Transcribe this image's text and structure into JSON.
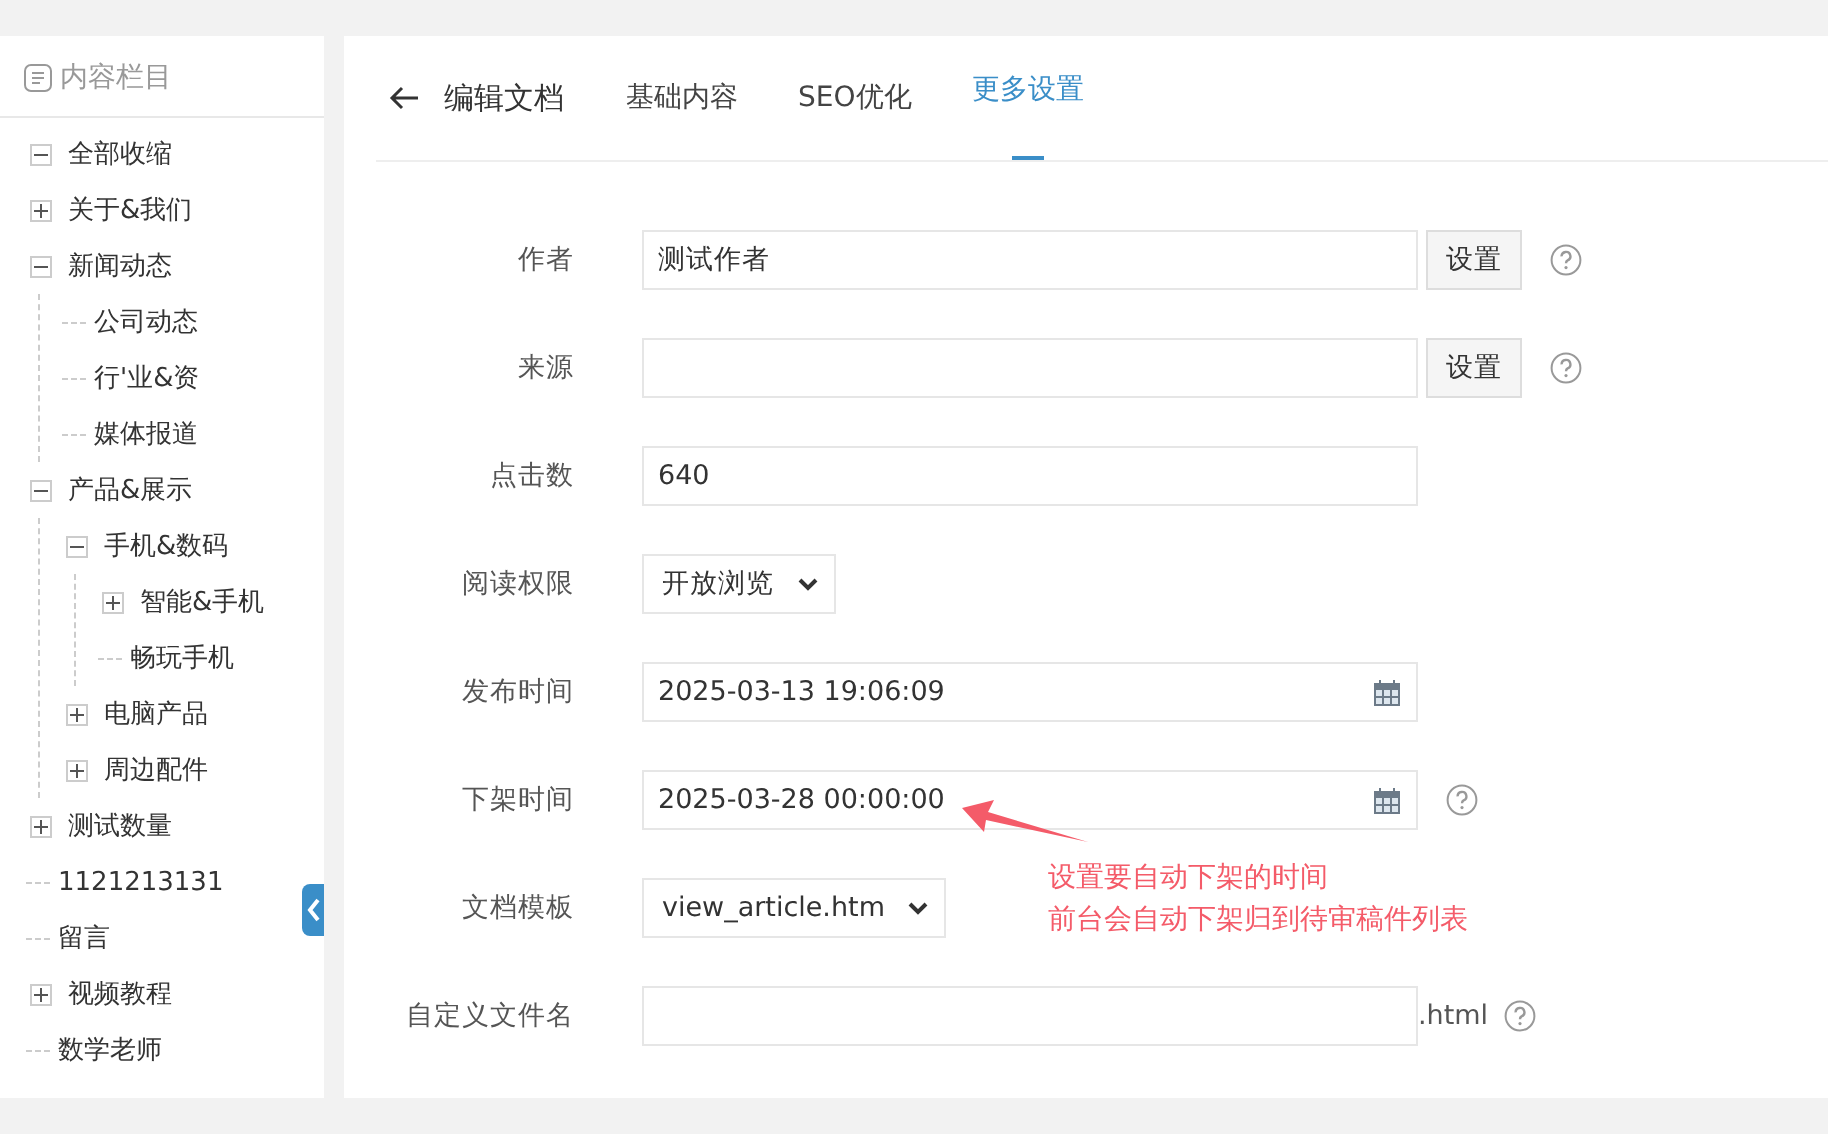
{
  "sidebar": {
    "title": "内容栏目",
    "tree": [
      {
        "label": "全部收缩",
        "expanded": true
      },
      {
        "label": "关于&我们",
        "expanded": false
      },
      {
        "label": "新闻动态",
        "expanded": true,
        "children": [
          {
            "label": "公司动态"
          },
          {
            "label": "行'业&资"
          },
          {
            "label": "媒体报道"
          }
        ]
      },
      {
        "label": "产品&展示",
        "expanded": true,
        "children": [
          {
            "label": "手机&数码",
            "expanded": true,
            "children": [
              {
                "label": "智能&手机",
                "expanded": false
              },
              {
                "label": "畅玩手机"
              }
            ]
          },
          {
            "label": "电脑产品",
            "expanded": false
          },
          {
            "label": "周边配件",
            "expanded": false
          }
        ]
      },
      {
        "label": "测试数量",
        "expanded": false
      },
      {
        "label": "1121213131"
      },
      {
        "label": "留言"
      },
      {
        "label": "视频教程",
        "expanded": false
      },
      {
        "label": "数学老师"
      }
    ]
  },
  "header": {
    "title": "编辑文档",
    "tabs": [
      {
        "label": "基础内容",
        "selected": false
      },
      {
        "label": "SEO优化",
        "selected": false
      },
      {
        "label": "更多设置",
        "selected": true
      }
    ]
  },
  "form": {
    "fields": [
      {
        "kind": "text",
        "label": "作者",
        "value": "测试作者",
        "button": "设置",
        "help": true
      },
      {
        "kind": "text",
        "label": "来源",
        "button": "设置",
        "help": true
      },
      {
        "kind": "text",
        "label": "点击数",
        "value": "640",
        "help": false
      },
      {
        "kind": "select",
        "label": "阅读权限",
        "value": "开放浏览",
        "help": false
      },
      {
        "kind": "date",
        "label": "发布时间",
        "value": "2025-03-13 19:06:09",
        "help": false
      },
      {
        "kind": "date",
        "label": "下架时间",
        "value": "2025-03-28 00:00:00",
        "help": true
      },
      {
        "kind": "select",
        "label": "文档模板",
        "value": "view_article.htm",
        "help": false
      },
      {
        "kind": "text",
        "label": "自定义文件名",
        "suffix": ".html",
        "help": true
      }
    ]
  },
  "annotation": {
    "lines": [
      "设置要自动下架的时间",
      "前台会自动下架归到待审稿件列表"
    ]
  }
}
